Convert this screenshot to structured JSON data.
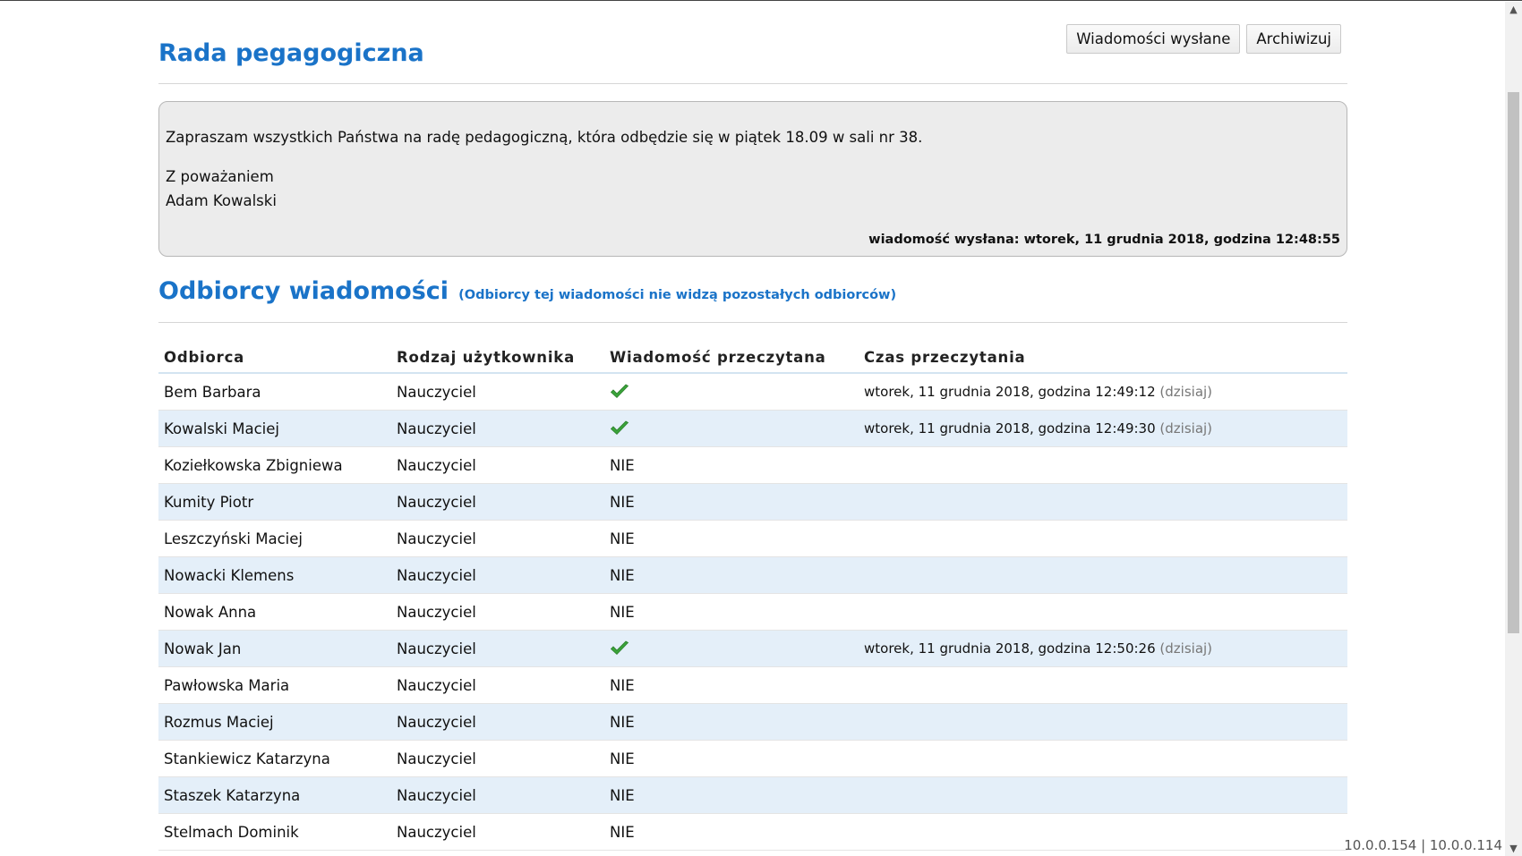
{
  "header": {
    "title": "Rada pegagogiczna",
    "buttons": {
      "sent": "Wiadomości wysłane",
      "archive": "Archiwizuj"
    }
  },
  "message": {
    "body": "Zapraszam wszystkich Państwa na radę pedagogiczną, która odbędzie się w piątek 18.09 w sali nr 38.",
    "greeting": "Z poważaniem",
    "signature": "Adam Kowalski",
    "sent_line": "wiadomość wysłana: wtorek, 11 grudnia 2018, godzina 12:48:55"
  },
  "recipients": {
    "title": "Odbiorcy wiadomości",
    "note": "(Odbiorcy tej wiadomości nie widzą pozostałych odbiorców)",
    "columns": [
      "Odbiorca",
      "Rodzaj użytkownika",
      "Wiadomość przeczytana",
      "Czas przeczytania"
    ],
    "today_label": "(dzisiaj)",
    "no_label": "NIE",
    "check_color": "#3aa33a",
    "rows": [
      {
        "name": "Bem Barbara",
        "type": "Nauczyciel",
        "read": true,
        "time": "wtorek, 11 grudnia 2018, godzina 12:49:12"
      },
      {
        "name": "Kowalski Maciej",
        "type": "Nauczyciel",
        "read": true,
        "time": "wtorek, 11 grudnia 2018, godzina 12:49:30"
      },
      {
        "name": "Koziełkowska Zbigniewa",
        "type": "Nauczyciel",
        "read": false,
        "time": ""
      },
      {
        "name": "Kumity Piotr",
        "type": "Nauczyciel",
        "read": false,
        "time": ""
      },
      {
        "name": "Leszczyński Maciej",
        "type": "Nauczyciel",
        "read": false,
        "time": ""
      },
      {
        "name": "Nowacki Klemens",
        "type": "Nauczyciel",
        "read": false,
        "time": ""
      },
      {
        "name": "Nowak Anna",
        "type": "Nauczyciel",
        "read": false,
        "time": ""
      },
      {
        "name": "Nowak Jan",
        "type": "Nauczyciel",
        "read": true,
        "time": "wtorek, 11 grudnia 2018, godzina 12:50:26"
      },
      {
        "name": "Pawłowska Maria",
        "type": "Nauczyciel",
        "read": false,
        "time": ""
      },
      {
        "name": "Rozmus Maciej",
        "type": "Nauczyciel",
        "read": false,
        "time": ""
      },
      {
        "name": "Stankiewicz Katarzyna",
        "type": "Nauczyciel",
        "read": false,
        "time": ""
      },
      {
        "name": "Staszek Katarzyna",
        "type": "Nauczyciel",
        "read": false,
        "time": ""
      },
      {
        "name": "Stelmach Dominik",
        "type": "Nauczyciel",
        "read": false,
        "time": ""
      }
    ]
  },
  "footer": {
    "ip_info": "10.0.0.154 | 10.0.0.114"
  },
  "colors": {
    "accent": "#1a73c8",
    "row_alt": "#e4eff9",
    "message_bg": "#ececec"
  }
}
